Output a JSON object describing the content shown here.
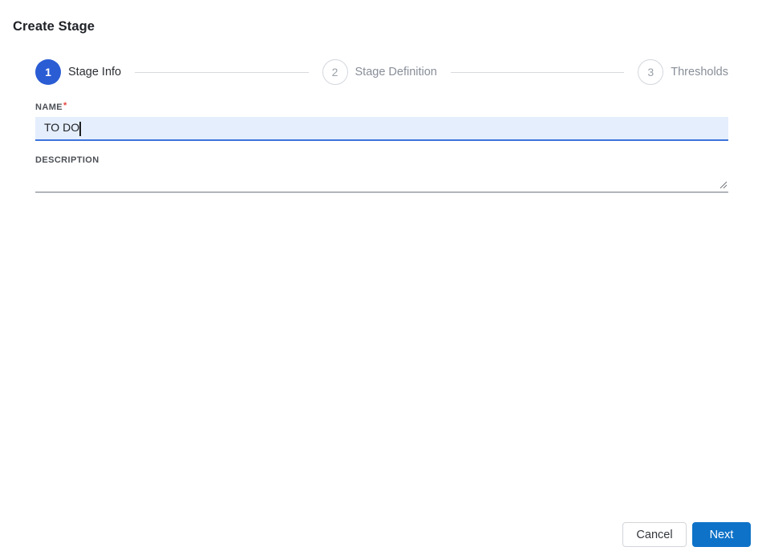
{
  "page": {
    "title": "Create Stage"
  },
  "stepper": {
    "steps": [
      {
        "number": "1",
        "label": "Stage Info",
        "state": "active"
      },
      {
        "number": "2",
        "label": "Stage Definition",
        "state": "inactive"
      },
      {
        "number": "3",
        "label": "Thresholds",
        "state": "inactive"
      }
    ]
  },
  "form": {
    "name": {
      "label": "NAME",
      "required_marker": "*",
      "value": "TO DO",
      "placeholder": ""
    },
    "description": {
      "label": "DESCRIPTION",
      "value": "",
      "placeholder": ""
    }
  },
  "footer": {
    "cancel_label": "Cancel",
    "next_label": "Next"
  },
  "colors": {
    "active_step_blue": "#2a5cd4",
    "primary_button_blue": "#0e72c8",
    "input_focus_background": "#e4eefc",
    "input_focus_underline": "#3e73dc",
    "required_asterisk_red": "#e8453c",
    "inactive_step_gray": "#9aa0a8",
    "connector_gray": "#d8dade"
  }
}
